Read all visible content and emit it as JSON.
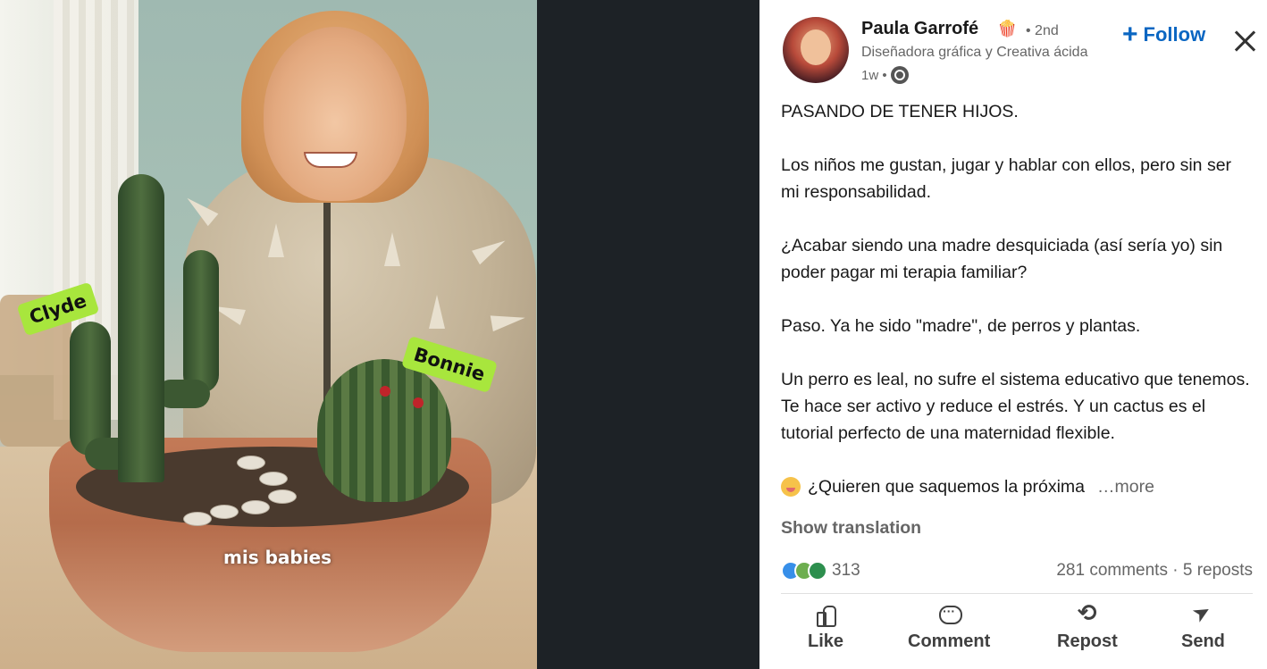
{
  "media": {
    "stickers": {
      "clyde": "Clyde",
      "bonnie": "Bonnie"
    },
    "caption": "mis babies"
  },
  "post": {
    "author": {
      "name": "Paula Garrofé",
      "emoji": "🍿",
      "degree": "• 2nd",
      "headline": "Diseñadora gráfica y Creativa ácida",
      "time": "1w •"
    },
    "follow_label": "Follow",
    "paragraphs": [
      "PASANDO DE TENER HIJOS.",
      "Los niños me gustan, jugar y hablar con ellos, pero sin ser mi responsabilidad.",
      "¿Acabar siendo una madre desquiciada (así sería yo) sin poder pagar mi terapia familiar?",
      "Paso. Ya he sido \"madre\", de perros y plantas.",
      "Un perro es leal, no sufre el sistema educativo que tenemos. Te hace ser activo y reduce el estrés. Y un cactus es el tutorial perfecto de una maternidad flexible."
    ],
    "last_line": "¿Quieren que saquemos la próxima",
    "more_label": "…more",
    "show_translation": "Show translation",
    "reaction_count": "313",
    "stats": "281 comments · 5 reposts",
    "actions": {
      "like": "Like",
      "comment": "Comment",
      "repost": "Repost",
      "send": "Send"
    }
  },
  "colors": {
    "accent": "#0a66c2",
    "sticker": "#a8e63d",
    "gap": "#1d2226"
  }
}
